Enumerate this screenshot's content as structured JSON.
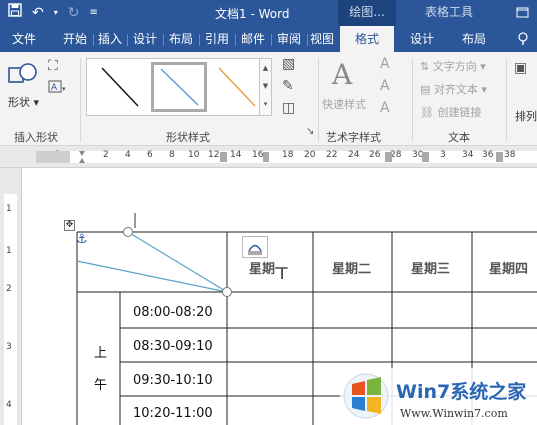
{
  "titlebar": {
    "doc_title": "文档1 - Word",
    "ctx_drawing": "绘图...",
    "ctx_table": "表格工具"
  },
  "tabs": [
    {
      "label": "文件"
    },
    {
      "label": "开始"
    },
    {
      "label": "插入"
    },
    {
      "label": "设计"
    },
    {
      "label": "布局"
    },
    {
      "label": "引用"
    },
    {
      "label": "邮件"
    },
    {
      "label": "审阅"
    },
    {
      "label": "视图"
    },
    {
      "label": "格式",
      "active": true
    },
    {
      "label": "设计"
    },
    {
      "label": "布局"
    }
  ],
  "ribbon": {
    "insert_shape_label": "形状",
    "insert_shape_group": "插入形状",
    "shape_styles_group": "形状样式",
    "quick_styles_label": "快速样式",
    "art_text_group": "艺术字样式",
    "text_direction": "文字方向",
    "align_text": "对齐文本",
    "create_link": "创建链接",
    "text_group": "文本",
    "arrange_label": "排列"
  },
  "ruler": {
    "h_ticks": [
      "2",
      "2",
      "4",
      "6",
      "8",
      "10",
      "12",
      "14",
      "16",
      "18",
      "20",
      "22",
      "24",
      "26",
      "28",
      "30",
      "3",
      "34",
      "36",
      "38"
    ],
    "v_ticks": [
      "1",
      "1",
      "2",
      "3",
      "4"
    ]
  },
  "table": {
    "headers": [
      "星期一",
      "星期二",
      "星期三",
      "星期四"
    ],
    "period_chars": [
      "上",
      "午"
    ],
    "times": [
      "08:00-08:20",
      "08:30-09:10",
      "09:30-10:10",
      "10:20-11:00"
    ]
  },
  "watermark": {
    "brand": "Win7系统之家",
    "url": "Www.Winwin7.com"
  },
  "colors": {
    "word_blue": "#2b579a",
    "diagonal_line": "#5ba3c9"
  }
}
